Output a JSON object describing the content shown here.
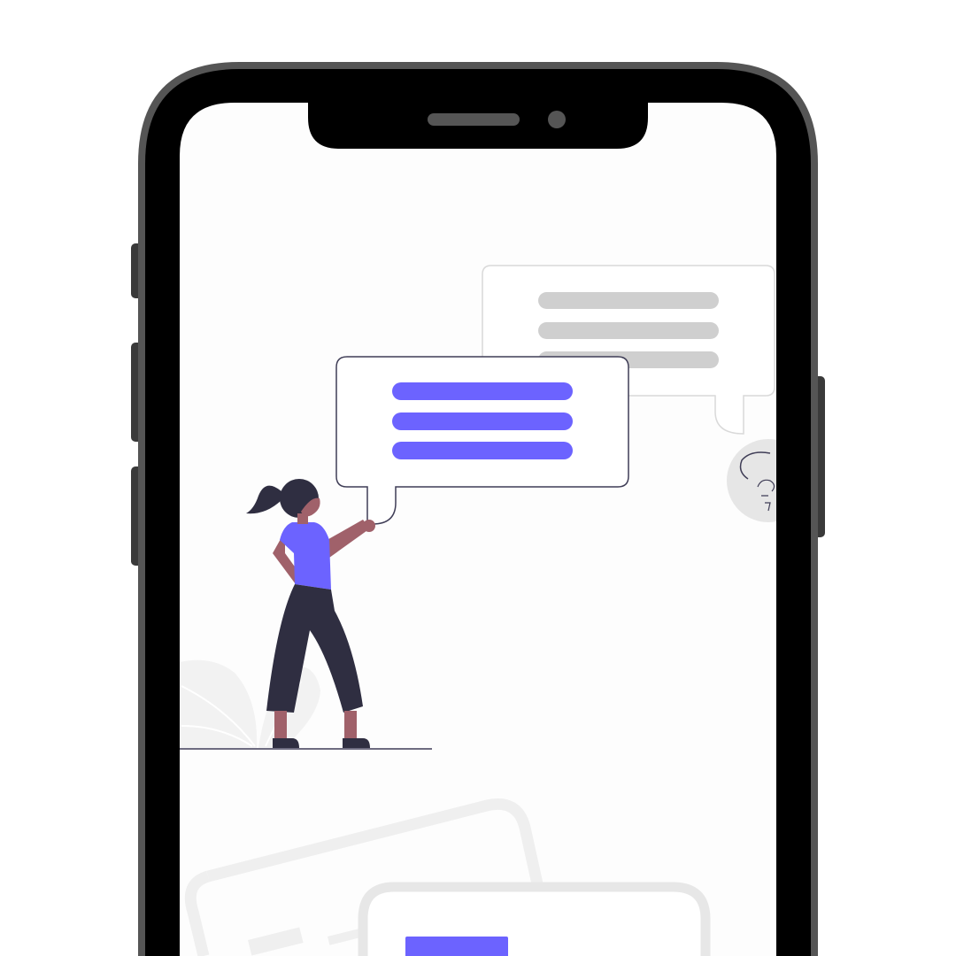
{
  "colors": {
    "background": "#ffffff",
    "phone_frame_outer": "#555555",
    "phone_frame_inner": "#000000",
    "screen": "#fdfdfd",
    "side_buttons": "#3a3a3a",
    "notch_speaker": "#555555",
    "notch_camera": "#555555",
    "accent": "#6c63ff",
    "muted_bar": "#cfcfcf",
    "muted_outline": "#d9d9d9",
    "dark_outline": "#3f3d56",
    "skin": "#a0616a",
    "hair": "#2f2e41",
    "pants": "#2f2e41",
    "foliage": "#f2f2f2",
    "ground_line": "#3f3d56"
  },
  "icons": {
    "phone": "smartphone-frame",
    "person": "woman-holding-speech-bubble",
    "chat_front": "speech-bubble-front",
    "chat_back": "speech-bubble-back",
    "avatar": "faded-avatar-icon",
    "plant": "decorative-plant"
  }
}
